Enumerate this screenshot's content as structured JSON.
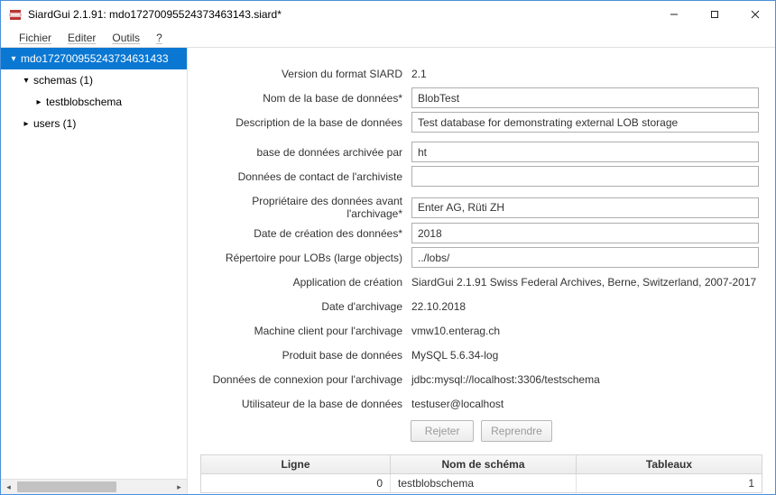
{
  "titlebar": {
    "title": "SiardGui 2.1.91: mdo17270095524373463143.siard*"
  },
  "menu": {
    "file": "Fichier",
    "edit": "Editer",
    "tools": "Outils",
    "help": "?"
  },
  "tree": {
    "root": "mdo172700955243734631433",
    "schemas": "schemas (1)",
    "schemaChild": "testblobschema",
    "users": "users (1)"
  },
  "form": {
    "labels": {
      "siardVersion": "Version du format SIARD",
      "dbName": "Nom de la base de données*",
      "dbDesc": "Description de la base de données",
      "archivedBy": "base de données archivée par",
      "contact": "Données de contact de l'archiviste",
      "owner": "Propriétaire des données avant l'archivage*",
      "creationDate": "Date de création des données*",
      "lobDir": "Répertoire pour LOBs (large objects)",
      "app": "Application de création",
      "archiveDate": "Date d'archivage",
      "machine": "Machine client pour l'archivage",
      "product": "Produit base de données",
      "connection": "Données de connexion pour l'archivage",
      "user": "Utilisateur de la base de données"
    },
    "values": {
      "siardVersion": "2.1",
      "dbName": "BlobTest",
      "dbDesc": "Test database for demonstrating external LOB storage",
      "archivedBy": "ht",
      "contact": "",
      "owner": "Enter AG, Rüti ZH",
      "creationDate": "2018",
      "lobDir": "../lobs/",
      "app": "SiardGui 2.1.91 Swiss Federal Archives, Berne, Switzerland, 2007-2017",
      "archiveDate": "22.10.2018",
      "machine": "vmw10.enterag.ch",
      "product": "MySQL 5.6.34-log",
      "connection": "jdbc:mysql://localhost:3306/testschema",
      "user": "testuser@localhost"
    }
  },
  "buttons": {
    "reject": "Rejeter",
    "resume": "Reprendre"
  },
  "table": {
    "headers": {
      "ligne": "Ligne",
      "nom": "Nom de schéma",
      "tableaux": "Tableaux"
    },
    "rows": [
      {
        "ligne": "0",
        "nom": "testblobschema",
        "tableaux": "1"
      }
    ]
  }
}
